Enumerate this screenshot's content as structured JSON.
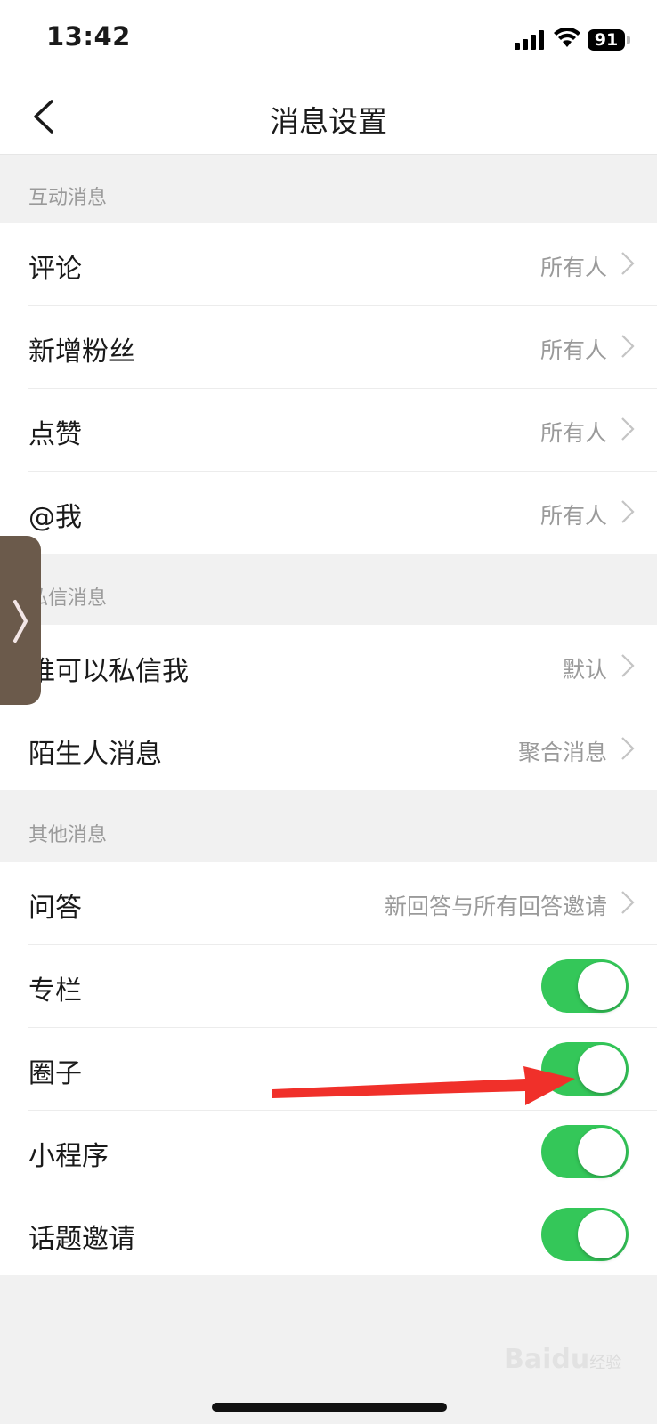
{
  "status_bar": {
    "time": "13:42",
    "battery": "91"
  },
  "nav": {
    "title": "消息设置"
  },
  "sections": [
    {
      "header": "互动消息",
      "rows": [
        {
          "label": "评论",
          "value": "所有人"
        },
        {
          "label": "新增粉丝",
          "value": "所有人"
        },
        {
          "label": "点赞",
          "value": "所有人"
        },
        {
          "label": "@我",
          "value": "所有人"
        }
      ]
    },
    {
      "header": "私信消息",
      "rows": [
        {
          "label": "谁可以私信我",
          "value": "默认"
        },
        {
          "label": "陌生人消息",
          "value": "聚合消息"
        }
      ]
    },
    {
      "header": "其他消息",
      "rows": [
        {
          "label": "问答",
          "value": "新回答与所有回答邀请"
        },
        {
          "label": "专栏",
          "toggle": true
        },
        {
          "label": "圈子",
          "toggle": true
        },
        {
          "label": "小程序",
          "toggle": true
        },
        {
          "label": "话题邀请",
          "toggle": true
        }
      ]
    }
  ],
  "watermark": {
    "brand": "Bai",
    "brand2": "du",
    "suffix": "经验"
  },
  "colors": {
    "toggle_on": "#34c759",
    "arrow": "#f0302a",
    "section_bg": "#f1f1f1"
  }
}
